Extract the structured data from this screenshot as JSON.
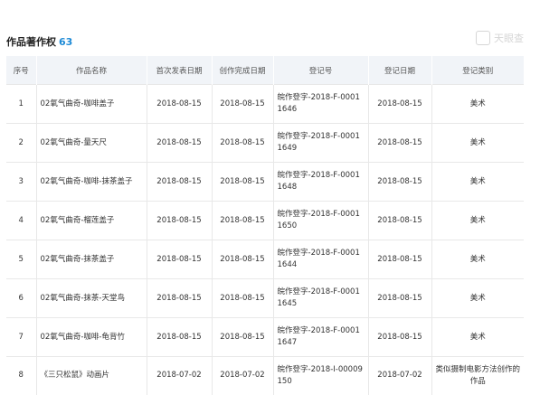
{
  "header": {
    "title": "作品著作权",
    "count": "63",
    "watermark_text": "天眼查"
  },
  "table": {
    "columns": [
      "序号",
      "作品名称",
      "首次发表日期",
      "创作完成日期",
      "登记号",
      "登记日期",
      "登记类别"
    ],
    "rows": [
      {
        "no": "1",
        "name": "02氧气曲奇-咖啡盖子",
        "published": "2018-08-15",
        "completed": "2018-08-15",
        "reg_no": "皖作登字-2018-F-00011646",
        "reg_date": "2018-08-15",
        "category": "美术"
      },
      {
        "no": "2",
        "name": "02氧气曲奇-量天尺",
        "published": "2018-08-15",
        "completed": "2018-08-15",
        "reg_no": "皖作登字-2018-F-00011649",
        "reg_date": "2018-08-15",
        "category": "美术"
      },
      {
        "no": "3",
        "name": "02氧气曲奇-咖啡-抹茶盖子",
        "published": "2018-08-15",
        "completed": "2018-08-15",
        "reg_no": "皖作登字-2018-F-00011648",
        "reg_date": "2018-08-15",
        "category": "美术"
      },
      {
        "no": "4",
        "name": "02氧气曲奇-榴莲盖子",
        "published": "2018-08-15",
        "completed": "2018-08-15",
        "reg_no": "皖作登字-2018-F-00011650",
        "reg_date": "2018-08-15",
        "category": "美术"
      },
      {
        "no": "5",
        "name": "02氧气曲奇-抹茶盖子",
        "published": "2018-08-15",
        "completed": "2018-08-15",
        "reg_no": "皖作登字-2018-F-00011644",
        "reg_date": "2018-08-15",
        "category": "美术"
      },
      {
        "no": "6",
        "name": "02氧气曲奇-抹茶-天堂鸟",
        "published": "2018-08-15",
        "completed": "2018-08-15",
        "reg_no": "皖作登字-2018-F-00011645",
        "reg_date": "2018-08-15",
        "category": "美术"
      },
      {
        "no": "7",
        "name": "02氧气曲奇-咖啡-龟背竹",
        "published": "2018-08-15",
        "completed": "2018-08-15",
        "reg_no": "皖作登字-2018-F-00011647",
        "reg_date": "2018-08-15",
        "category": "美术"
      },
      {
        "no": "8",
        "name": "《三只松鼠》动画片",
        "published": "2018-07-02",
        "completed": "2018-07-02",
        "reg_no": "皖作登字-2018-I-00009150",
        "reg_date": "2018-07-02",
        "category": "类似摄制电影方法创作的作品"
      }
    ]
  }
}
